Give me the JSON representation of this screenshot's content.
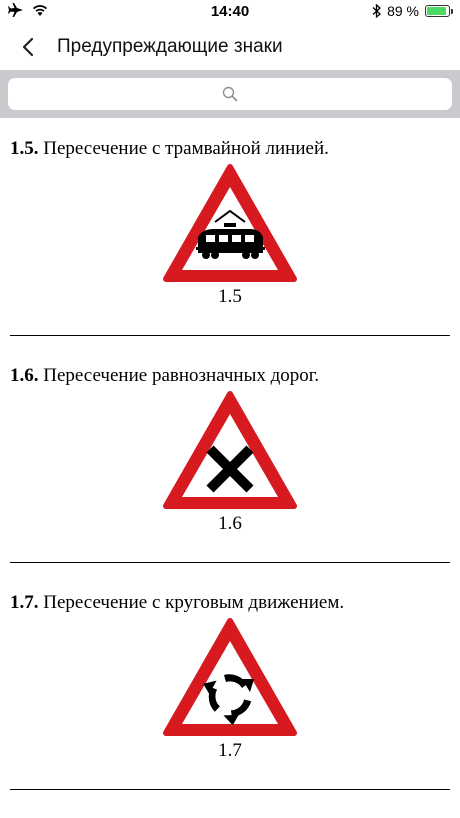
{
  "status_bar": {
    "time": "14:40",
    "battery_text": "89 %",
    "battery_level": 0.89,
    "icons": [
      "airplane-icon",
      "wifi-icon",
      "bluetooth-icon",
      "battery-icon"
    ]
  },
  "nav": {
    "title": "Предупреждающие знаки",
    "back_icon": "chevron-left-icon"
  },
  "search": {
    "icon": "search-icon",
    "placeholder": ""
  },
  "signs": [
    {
      "number": "1.5.",
      "title": "Пересечение с трамвайной линией.",
      "caption": "1.5",
      "symbol": "tram-icon"
    },
    {
      "number": "1.6.",
      "title": "Пересечение равнозначных дорог.",
      "caption": "1.6",
      "symbol": "cross-icon"
    },
    {
      "number": "1.7.",
      "title": "Пересечение с круговым движением.",
      "caption": "1.7",
      "symbol": "roundabout-icon"
    }
  ],
  "colors": {
    "sign_red": "#d71920",
    "search_bg": "#c9c9ce",
    "battery_green": "#4cd964"
  }
}
